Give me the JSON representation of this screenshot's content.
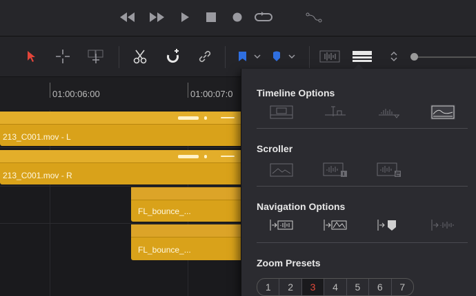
{
  "transport": {
    "icons": [
      "rewind-icon",
      "fast-forward-icon",
      "play-icon",
      "stop-icon",
      "record-icon",
      "loop-icon",
      "curve-icon"
    ]
  },
  "toolbar": {
    "icons": [
      "selection-arrow-icon",
      "trim-edit-icon",
      "dynamic-trim-icon",
      "blade-icon",
      "snapping-icon",
      "linked-selection-icon",
      "flag-icon",
      "marker-icon",
      "audio-waveform-icon",
      "timeline-view-options-icon",
      "zoom-height-icon"
    ],
    "colors": {
      "selection": "#e2453a",
      "flag": "#2f6fe0",
      "marker": "#2f6fe0"
    }
  },
  "ruler": {
    "labels": [
      "01:00:06:00",
      "01:00:07:0"
    ]
  },
  "clips": {
    "audio_l": "213_C001.mov - L",
    "audio_r": "213_C001.mov - R",
    "bounce_1": "FL_bounce_...",
    "bounce_2": "FL_bounce_..."
  },
  "popover": {
    "timeline_options": {
      "title": "Timeline Options",
      "options": [
        "stacked-timelines-icon",
        "subtitle-tracks-icon",
        "audio-waveforms-icon",
        "video-waveform-thumb-icon"
      ],
      "active_index": 3
    },
    "scroller": {
      "title": "Scroller",
      "options": [
        "video-scroller-icon",
        "audio-scroller-1-icon",
        "audio-scroller-2-icon"
      ]
    },
    "navigation": {
      "title": "Navigation Options",
      "options": [
        "jump-to-audio-icon",
        "jump-to-video-audio-icon",
        "jump-to-marker-icon",
        "jump-to-subclip-icon"
      ]
    },
    "zoom_presets": {
      "title": "Zoom Presets",
      "values": [
        "1",
        "2",
        "3",
        "4",
        "5",
        "6",
        "7"
      ],
      "selected": "3",
      "selected_color": "#e64b3c"
    }
  }
}
